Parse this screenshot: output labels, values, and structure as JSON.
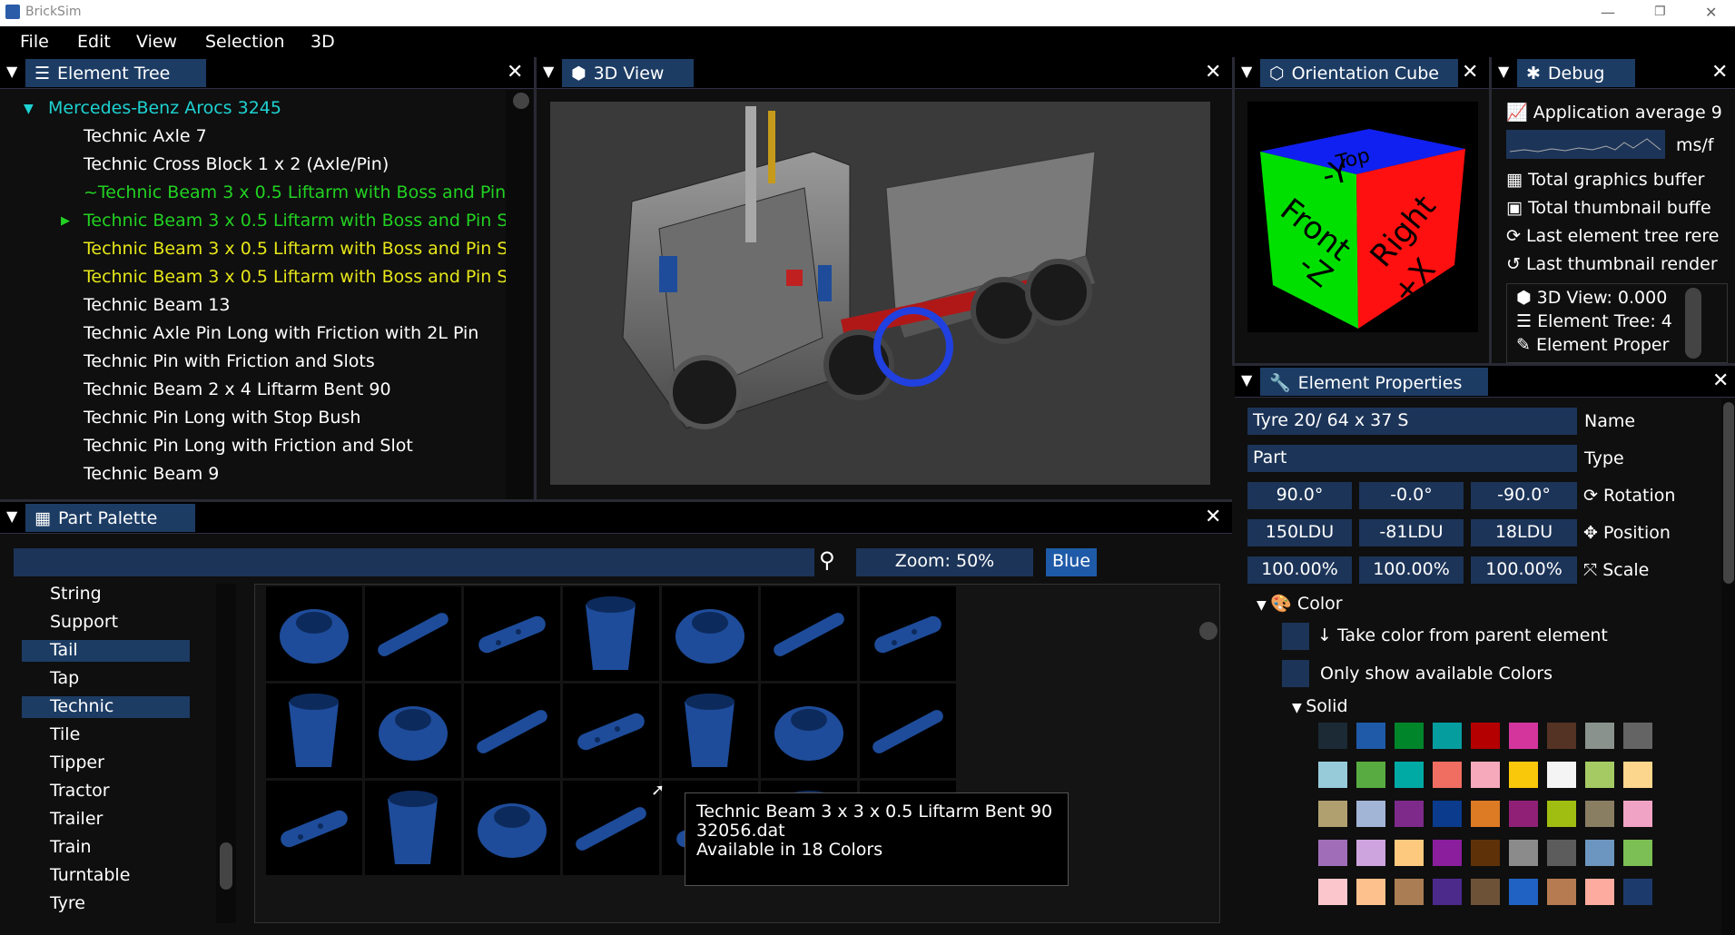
{
  "window": {
    "title": "BrickSim",
    "minimize_glyph": "—",
    "restore_glyph": "❐",
    "close_glyph": "✕"
  },
  "menu": [
    "File",
    "Edit",
    "View",
    "Selection",
    "3D"
  ],
  "element_tree": {
    "tab_label": "Element Tree",
    "root": "Mercedes-Benz Arocs 3245",
    "items": [
      {
        "text": "Technic Axle  7",
        "color": "w"
      },
      {
        "text": "Technic Cross Block 1 x 2 (Axle/Pin)",
        "color": "w"
      },
      {
        "text": "~Technic Beam  3 x  0.5 Liftarm with Boss and Pin",
        "color": "g"
      },
      {
        "text": "Technic Beam  3 x  0.5 Liftarm with Boss and Pin S",
        "color": "g"
      },
      {
        "text": "Technic Beam  3 x  0.5 Liftarm with Boss and Pin S",
        "color": "y"
      },
      {
        "text": "Technic Beam  3 x  0.5 Liftarm with Boss and Pin S",
        "color": "y"
      },
      {
        "text": "Technic Beam 13",
        "color": "w"
      },
      {
        "text": "Technic Axle Pin Long with Friction with  2L Pin",
        "color": "w"
      },
      {
        "text": "Technic Pin with Friction and Slots",
        "color": "w"
      },
      {
        "text": "Technic Beam  2 x  4 Liftarm Bent 90",
        "color": "w"
      },
      {
        "text": "Technic Pin Long with Stop Bush",
        "color": "w"
      },
      {
        "text": "Technic Pin Long with Friction and Slot",
        "color": "w"
      },
      {
        "text": "Technic Beam  9",
        "color": "w"
      }
    ]
  },
  "view3d": {
    "tab_label": "3D View"
  },
  "orientation_cube": {
    "tab_label": "Orientation Cube",
    "faces": {
      "front": "Front",
      "front_axis": "-Z",
      "right": "Right",
      "right_axis": "+X",
      "top": "Top",
      "top_axis": "-Y"
    }
  },
  "debug": {
    "tab_label": "Debug",
    "lines": [
      "Application average 9",
      "Total graphics buffer",
      "Total thumbnail buffe",
      "Last element tree rere",
      "Last thumbnail render"
    ],
    "unit": "ms/f",
    "sub_lines": [
      "3D View: 0.000",
      "Element Tree: 4",
      "Element Proper"
    ]
  },
  "properties": {
    "tab_label": "Element Properties",
    "name_value": "Tyre 20/ 64 x 37 S",
    "name_label": "Name",
    "type_value": "Part",
    "type_label": "Type",
    "rotation": [
      "90.0°",
      "-0.0°",
      "-90.0°"
    ],
    "rotation_label": "Rotation",
    "position": [
      "150LDU",
      "-81LDU",
      "18LDU"
    ],
    "position_label": "Position",
    "scale": [
      "100.00%",
      "100.00%",
      "100.00%"
    ],
    "scale_label": "Scale",
    "color_header": "Color",
    "take_color": "Take color from parent element",
    "only_available": "Only show available Colors",
    "solid_header": "Solid",
    "swatches": [
      [
        "#1b2a34",
        "#1e5aa8",
        "#00852b",
        "#069d9f",
        "#b40000",
        "#d3359d",
        "#543324",
        "#8a928d",
        "#646464"
      ],
      [
        "#97cbd9",
        "#58ab41",
        "#00aaa4",
        "#f06d61",
        "#f6a9bb",
        "#fac80a",
        "#f4f4f4",
        "#a5ca64",
        "#fcd68d"
      ],
      [
        "#b0a06f",
        "#a3b5d6",
        "#7d2a8b",
        "#0a3b8d",
        "#dd7a24",
        "#901f76",
        "#a0bd11",
        "#897d62",
        "#f0a3c4"
      ],
      [
        "#a06eb9",
        "#cda4de",
        "#fcc97e",
        "#8a1e9d",
        "#5f3109",
        "#8b8b8b",
        "#5c5c5c",
        "#6c96bf",
        "#7cbf54"
      ],
      [
        "#fcc7cc",
        "#fcc18c",
        "#aa7d55",
        "#4c2a8c",
        "#6e5238",
        "#2062c3",
        "#b67b50",
        "#fcab9e",
        "#1d3a6d"
      ]
    ]
  },
  "palette": {
    "tab_label": "Part Palette",
    "search_value": "",
    "zoom_label": "Zoom: 50%",
    "color_button": "Blue",
    "categories": [
      "String",
      "Support",
      "Tail",
      "Tap",
      "Technic",
      "Tile",
      "Tipper",
      "Tractor",
      "Trailer",
      "Train",
      "Turntable",
      "Tyre"
    ],
    "selected_categories": [
      "Tail",
      "Technic"
    ],
    "tooltip": [
      "Technic Beam  3 x  3 x  0.5 Liftarm Bent 90",
      "32056.dat",
      "Available in 18 Colors"
    ]
  }
}
